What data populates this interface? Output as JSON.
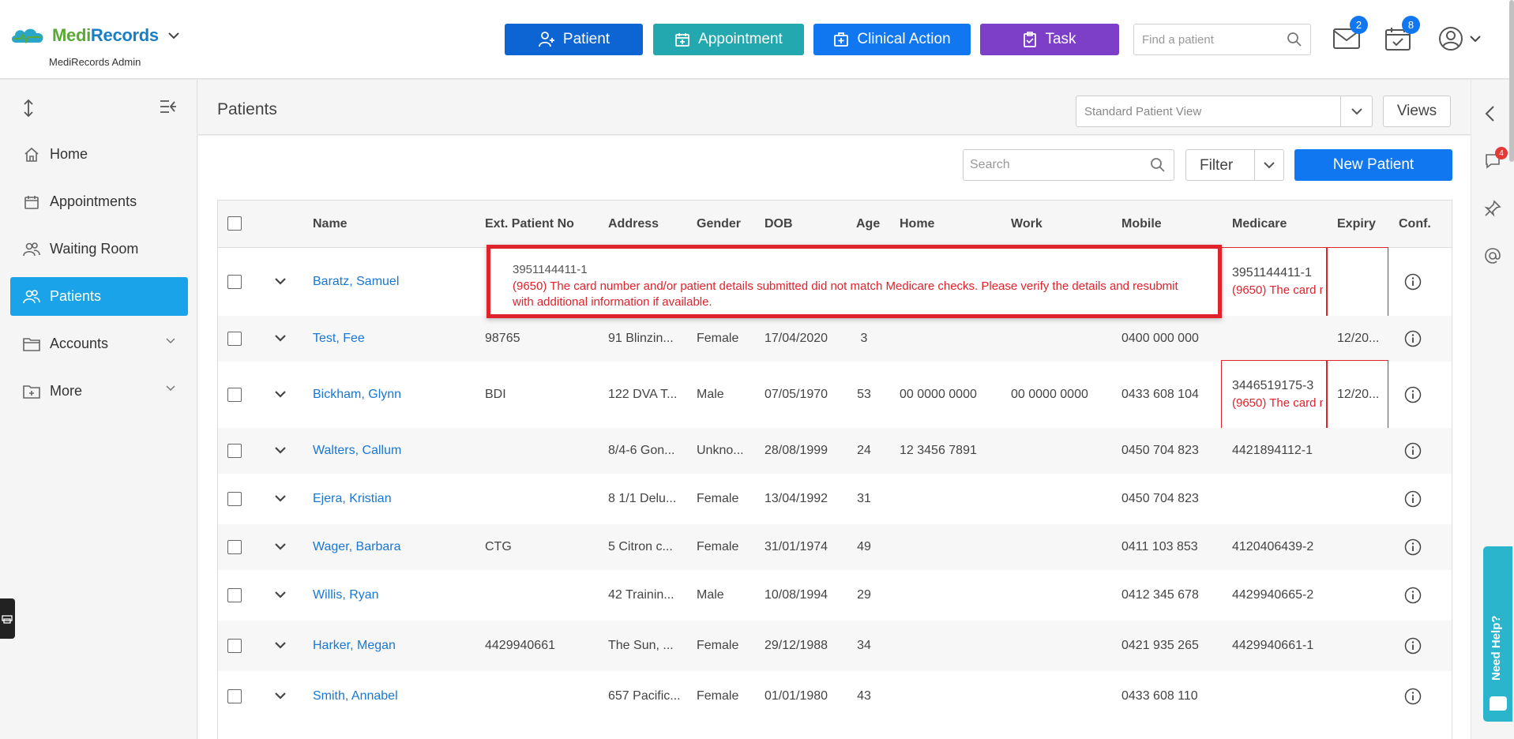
{
  "app": {
    "brand_part1": "Medi",
    "brand_part2": "Records",
    "subtitle": "MediRecords Admin"
  },
  "header": {
    "buttons": [
      {
        "label": "Patient",
        "icon": "add-person-icon",
        "color": "#0d64d3"
      },
      {
        "label": "Appointment",
        "icon": "calendar-plus-icon",
        "color": "#23a8b0"
      },
      {
        "label": "Clinical Action",
        "icon": "medical-bag-icon",
        "color": "#1077f0"
      },
      {
        "label": "Task",
        "icon": "clipboard-check-icon",
        "color": "#7d3fc8"
      }
    ],
    "find_patient_placeholder": "Find a patient",
    "mail_badge": "2",
    "calendar_badge": "8"
  },
  "sidebar": {
    "items": [
      {
        "label": "Home",
        "icon": "home-icon"
      },
      {
        "label": "Appointments",
        "icon": "calendar-icon"
      },
      {
        "label": "Waiting Room",
        "icon": "people-icon"
      },
      {
        "label": "Patients",
        "icon": "patients-icon",
        "active": true
      },
      {
        "label": "Accounts",
        "icon": "folder-icon",
        "expandable": true
      },
      {
        "label": "More",
        "icon": "folder-plus-icon",
        "expandable": true
      }
    ]
  },
  "right_rail": {
    "comments_badge": "4",
    "need_help": "Need Help?"
  },
  "page": {
    "title": "Patients",
    "view_select": "Standard Patient View",
    "views_label": "Views",
    "search_placeholder": "Search",
    "filter_label": "Filter",
    "new_patient_label": "New Patient"
  },
  "table": {
    "columns": [
      "Name",
      "Ext. Patient No",
      "Address",
      "Gender",
      "DOB",
      "Age",
      "Home",
      "Work",
      "Mobile",
      "Medicare",
      "Expiry",
      "Conf."
    ],
    "rows": [
      {
        "name": "Baratz, Samuel",
        "ext": "",
        "address": "",
        "gender": "",
        "dob": "",
        "age": "",
        "home": "",
        "work": "",
        "mobile": "",
        "medicare": "3951144411-1",
        "medicare_error": "(9650) The card n",
        "expiry": ""
      },
      {
        "name": "Test, Fee",
        "ext": "98765",
        "address": "91 Blinzin...",
        "gender": "Female",
        "dob": "17/04/2020",
        "age": "3",
        "home": "",
        "work": "",
        "mobile": "0400 000 000",
        "medicare": "",
        "medicare_error": "",
        "expiry": "12/20..."
      },
      {
        "name": "Bickham, Glynn",
        "ext": "BDI",
        "address": "122 DVA T...",
        "gender": "Male",
        "dob": "07/05/1970",
        "age": "53",
        "home": "00 0000 0000",
        "work": "00 0000 0000",
        "mobile": "0433 608 104",
        "medicare": "3446519175-3",
        "medicare_error": "(9650) The card n",
        "expiry": "12/20..."
      },
      {
        "name": "Walters, Callum",
        "ext": "",
        "address": "8/4-6 Gon...",
        "gender": "Unkno...",
        "dob": "28/08/1999",
        "age": "24",
        "home": "12 3456 7891",
        "work": "",
        "mobile": "0450 704 823",
        "medicare": "4421894112-1",
        "medicare_error": "",
        "expiry": ""
      },
      {
        "name": "Ejera, Kristian",
        "ext": "",
        "address": "8 1/1 Delu...",
        "gender": "Female",
        "dob": "13/04/1992",
        "age": "31",
        "home": "",
        "work": "",
        "mobile": "0450 704 823",
        "medicare": "",
        "medicare_error": "",
        "expiry": ""
      },
      {
        "name": "Wager, Barbara",
        "ext": "CTG",
        "address": "5 Citron c...",
        "gender": "Female",
        "dob": "31/01/1974",
        "age": "49",
        "home": "",
        "work": "",
        "mobile": "0411 103 853",
        "medicare": "4120406439-2",
        "medicare_error": "",
        "expiry": ""
      },
      {
        "name": "Willis, Ryan",
        "ext": "",
        "address": "42 Trainin...",
        "gender": "Male",
        "dob": "10/08/1994",
        "age": "29",
        "home": "",
        "work": "",
        "mobile": "0412 345 678",
        "medicare": "4429940665-2",
        "medicare_error": "",
        "expiry": ""
      },
      {
        "name": "Harker, Megan",
        "ext": "4429940661",
        "address": "The Sun, ...",
        "gender": "Female",
        "dob": "29/12/1988",
        "age": "34",
        "home": "",
        "work": "",
        "mobile": "0421 935 265",
        "medicare": "4429940661-1",
        "medicare_error": "",
        "expiry": ""
      },
      {
        "name": "Smith, Annabel",
        "ext": "",
        "address": "657 Pacific...",
        "gender": "Female",
        "dob": "01/01/1980",
        "age": "43",
        "home": "",
        "work": "",
        "mobile": "0433 608 110",
        "medicare": "",
        "medicare_error": "",
        "expiry": ""
      }
    ]
  },
  "tooltip": {
    "number": "3951144411-1",
    "message": "(9650) The card number and/or patient details submitted did not match Medicare checks. Please verify the details and resubmit with additional information if available."
  }
}
